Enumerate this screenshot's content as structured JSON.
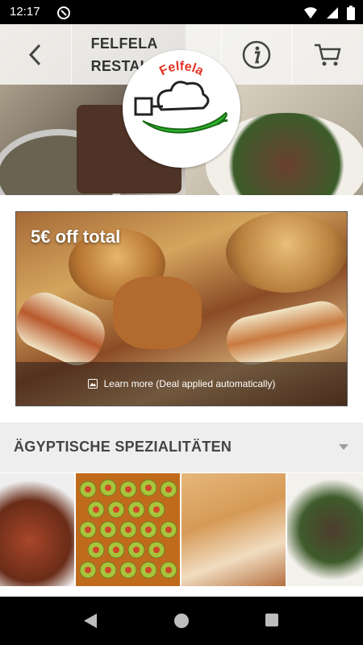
{
  "status_bar": {
    "time": "12:17"
  },
  "header": {
    "title_line1": "FELFELA",
    "title_line2": "RESTAURANT"
  },
  "logo": {
    "text": "Felfela"
  },
  "promo": {
    "headline": "5€ off total",
    "footer_text": "Learn more (Deal applied automatically)"
  },
  "section": {
    "title": "ÄGYPTISCHE SPEZIALITÄTEN"
  },
  "colors": {
    "accent_green": "#2fb32b",
    "section_bg": "#eeeeee"
  }
}
